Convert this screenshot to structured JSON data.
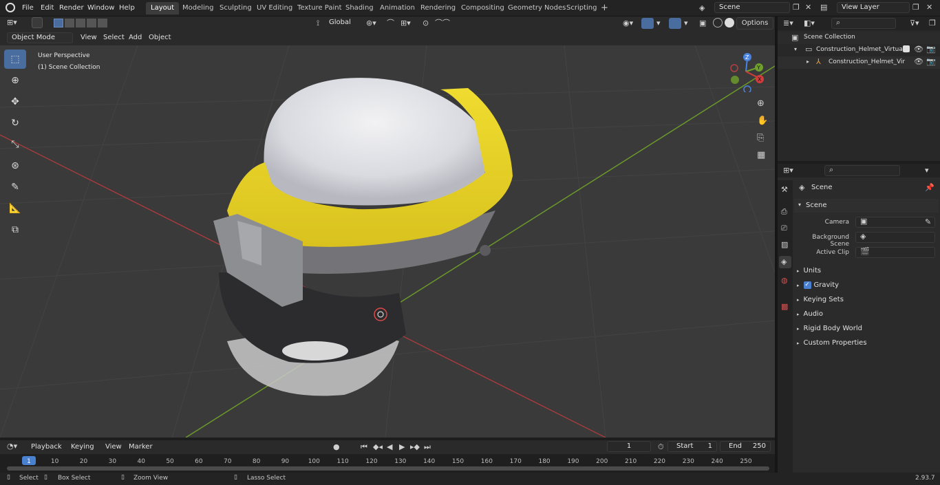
{
  "app": {
    "version": "2.93.7"
  },
  "menu": [
    "File",
    "Edit",
    "Render",
    "Window",
    "Help"
  ],
  "workspaces": [
    "Layout",
    "Modeling",
    "Sculpting",
    "UV Editing",
    "Texture Paint",
    "Shading",
    "Animation",
    "Rendering",
    "Compositing",
    "Geometry Nodes",
    "Scripting"
  ],
  "active_workspace": "Layout",
  "scene_field": "Scene",
  "view_layer_field": "View Layer",
  "viewport_header": {
    "mode": "Object Mode",
    "menus": [
      "View",
      "Select",
      "Add",
      "Object"
    ],
    "transform_orientation": "Global",
    "options": "Options"
  },
  "overlay_text": {
    "line1": "User Perspective",
    "line2": "(1) Scene Collection"
  },
  "gizmo": {
    "z": "Z",
    "y": "Y",
    "x": "X"
  },
  "outliner": {
    "root": "Scene Collection",
    "items": [
      {
        "label": "Construction_Helmet_Virtual_"
      },
      {
        "label": "Construction_Helmet_Vir"
      }
    ]
  },
  "properties": {
    "context": "Scene",
    "section": "Scene",
    "fields": [
      {
        "label": "Camera"
      },
      {
        "label": "Background Scene"
      },
      {
        "label": "Active Clip"
      }
    ],
    "panels": [
      "Units",
      "Gravity",
      "Keying Sets",
      "Audio",
      "Rigid Body World",
      "Custom Properties"
    ],
    "gravity_checked": true
  },
  "timeline": {
    "menus": [
      "Playback",
      "Keying",
      "View",
      "Marker"
    ],
    "current_frame": "1",
    "start_label": "Start",
    "start": "1",
    "end_label": "End",
    "end": "250",
    "ticks": [
      "1",
      "10",
      "20",
      "30",
      "40",
      "50",
      "60",
      "70",
      "80",
      "90",
      "100",
      "110",
      "120",
      "130",
      "140",
      "150",
      "160",
      "170",
      "180",
      "190",
      "200",
      "210",
      "220",
      "230",
      "240",
      "250"
    ]
  },
  "statusbar": {
    "select": "Select",
    "box_select": "Box Select",
    "zoom_view": "Zoom View",
    "lasso_select": "Lasso Select"
  }
}
